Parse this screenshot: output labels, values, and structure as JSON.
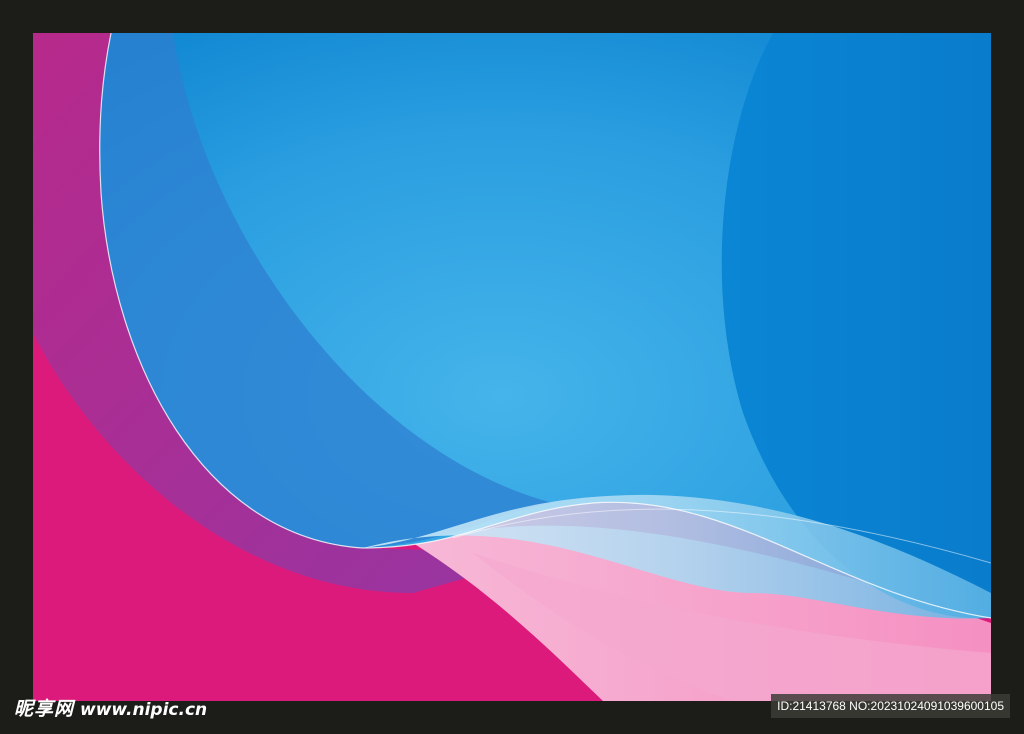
{
  "watermark": {
    "logo_text": "昵享网",
    "site": "www.nipic.cn",
    "id_text": "ID:21413768 NO:20231024091039600105"
  },
  "colors": {
    "border": "#1c1c18",
    "magenta": "#dc1a7c",
    "blue": "#1a8ed8",
    "light_blue": "#3ab0ea",
    "pink": "#f3a6cf"
  }
}
